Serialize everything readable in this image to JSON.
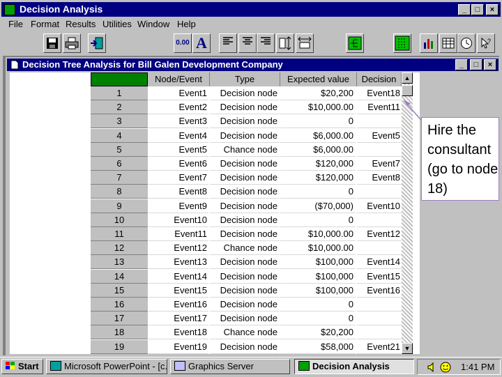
{
  "app": {
    "title": "Decision Analysis"
  },
  "menu": [
    "File",
    "Format",
    "Results",
    "Utilities",
    "Window",
    "Help"
  ],
  "toolbar": {
    "decimal_label": "0.00",
    "font_label": "A"
  },
  "child": {
    "title": "Decision Tree Analysis for Bill Galen Development Company"
  },
  "table": {
    "headers": [
      "Node/Event",
      "Type",
      "Expected value",
      "Decision"
    ],
    "rows": [
      {
        "num": "1",
        "node": "Event1",
        "type": "Decision node",
        "ev": "$20,200",
        "dec": "Event18"
      },
      {
        "num": "2",
        "node": "Event2",
        "type": "Decision node",
        "ev": "$10,000.00",
        "dec": "Event11"
      },
      {
        "num": "3",
        "node": "Event3",
        "type": "Decision node",
        "ev": "0",
        "dec": ""
      },
      {
        "num": "4",
        "node": "Event4",
        "type": "Decision node",
        "ev": "$6,000.00",
        "dec": "Event5"
      },
      {
        "num": "5",
        "node": "Event5",
        "type": "Chance node",
        "ev": "$6,000.00",
        "dec": ""
      },
      {
        "num": "6",
        "node": "Event6",
        "type": "Decision node",
        "ev": "$120,000",
        "dec": "Event7"
      },
      {
        "num": "7",
        "node": "Event7",
        "type": "Decision node",
        "ev": "$120,000",
        "dec": "Event8"
      },
      {
        "num": "8",
        "node": "Event8",
        "type": "Decision node",
        "ev": "0",
        "dec": ""
      },
      {
        "num": "9",
        "node": "Event9",
        "type": "Decision node",
        "ev": "($70,000)",
        "dec": "Event10"
      },
      {
        "num": "10",
        "node": "Event10",
        "type": "Decision node",
        "ev": "0",
        "dec": ""
      },
      {
        "num": "11",
        "node": "Event11",
        "type": "Decision node",
        "ev": "$10,000.00",
        "dec": "Event12"
      },
      {
        "num": "12",
        "node": "Event12",
        "type": "Chance node",
        "ev": "$10,000.00",
        "dec": ""
      },
      {
        "num": "13",
        "node": "Event13",
        "type": "Decision node",
        "ev": "$100,000",
        "dec": "Event14"
      },
      {
        "num": "14",
        "node": "Event14",
        "type": "Decision node",
        "ev": "$100,000",
        "dec": "Event15"
      },
      {
        "num": "15",
        "node": "Event15",
        "type": "Decision node",
        "ev": "$100,000",
        "dec": "Event16"
      },
      {
        "num": "16",
        "node": "Event16",
        "type": "Decision node",
        "ev": "0",
        "dec": ""
      },
      {
        "num": "17",
        "node": "Event17",
        "type": "Decision node",
        "ev": "0",
        "dec": ""
      },
      {
        "num": "18",
        "node": "Event18",
        "type": "Chance node",
        "ev": "$20,200",
        "dec": ""
      },
      {
        "num": "19",
        "node": "Event19",
        "type": "Decision node",
        "ev": "$58,000",
        "dec": "Event21"
      }
    ]
  },
  "callout": {
    "text": "Hire the consultant (go to node 18)"
  },
  "taskbar": {
    "start": "Start",
    "tasks": [
      "Microsoft PowerPoint - [c...",
      "Graphics Server",
      "Decision Analysis"
    ],
    "clock": "1:41 PM"
  },
  "colors": {
    "title_bar": "#000080",
    "face": "#c0c0c0",
    "selected_header": "#008000",
    "callout_border": "#9a7fc0"
  }
}
